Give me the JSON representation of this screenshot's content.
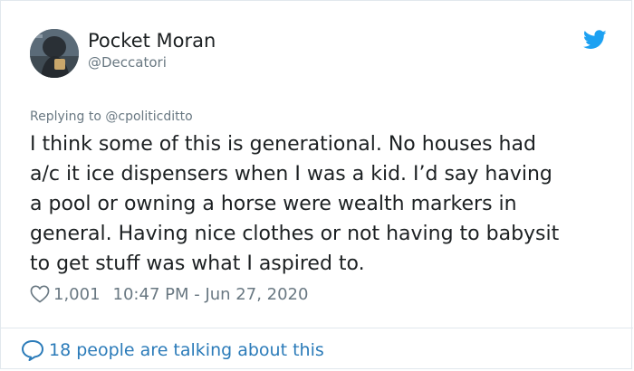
{
  "author": {
    "display_name": "Pocket Moran",
    "handle": "@Deccatori"
  },
  "reply_context": "Replying to @cpoliticditto",
  "tweet_lines": [
    "I think some of this is generational. No houses had",
    "a/c it ice dispensers when I was a kid. I’d say having",
    "a pool or owning a horse were wealth markers in",
    "general. Having nice clothes or not having to babysit",
    "to get stuff was what I aspired to."
  ],
  "stats": {
    "likes": "1,001",
    "timestamp": "10:47 PM - Jun 27, 2020"
  },
  "footer": {
    "talking_label": "18 people are talking about this"
  },
  "icons": {
    "logo": "twitter-bird-icon",
    "like": "heart-icon",
    "conversation": "speech-bubble-icon"
  },
  "colors": {
    "twitter_blue": "#1da1f2",
    "link_blue": "#2b7bb9",
    "text": "#1c2022",
    "muted": "#697882",
    "border": "#e1e8ed"
  }
}
